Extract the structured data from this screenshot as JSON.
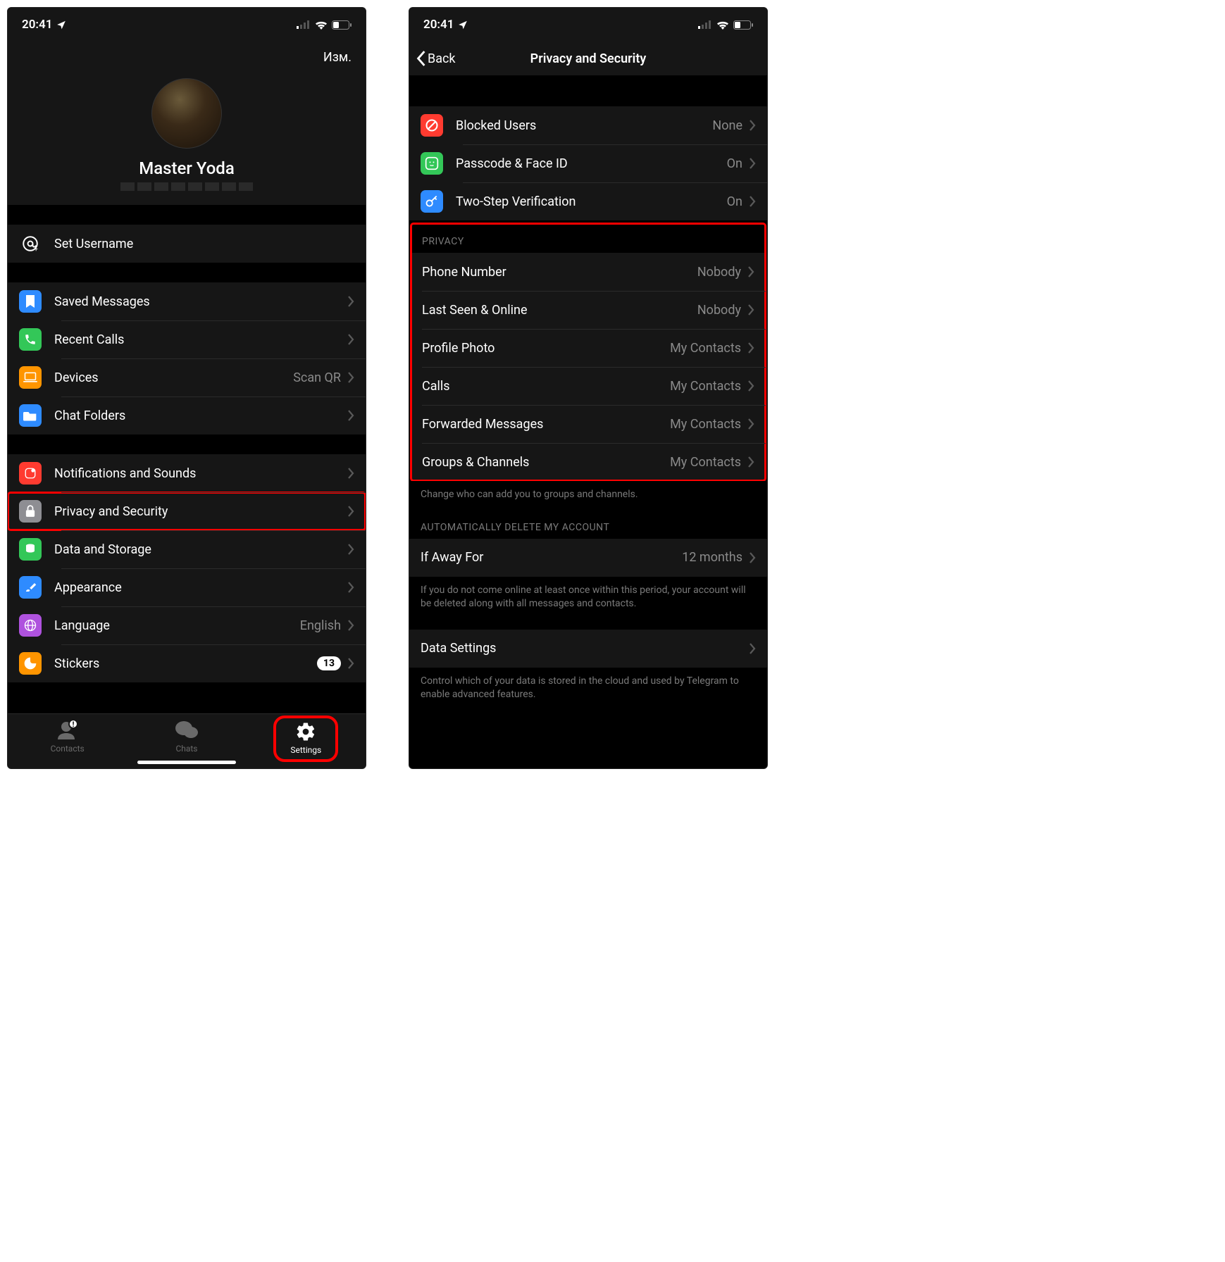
{
  "status": {
    "time": "20:41"
  },
  "left": {
    "edit_label": "Изм.",
    "profile_name": "Master Yoda",
    "rows": {
      "set_username": "Set Username",
      "saved_messages": "Saved Messages",
      "recent_calls": "Recent Calls",
      "devices": "Devices",
      "devices_value": "Scan QR",
      "chat_folders": "Chat Folders",
      "notifications": "Notifications and Sounds",
      "privacy": "Privacy and Security",
      "data_storage": "Data and Storage",
      "appearance": "Appearance",
      "language": "Language",
      "language_value": "English",
      "stickers": "Stickers",
      "stickers_badge": "13"
    },
    "tabs": {
      "contacts": "Contacts",
      "chats": "Chats",
      "settings": "Settings"
    }
  },
  "right": {
    "back_label": "Back",
    "title": "Privacy and Security",
    "security": {
      "blocked": {
        "label": "Blocked Users",
        "value": "None"
      },
      "passcode": {
        "label": "Passcode & Face ID",
        "value": "On"
      },
      "twostep": {
        "label": "Two-Step Verification",
        "value": "On"
      }
    },
    "privacy_header": "PRIVACY",
    "privacy": {
      "phone": {
        "label": "Phone Number",
        "value": "Nobody"
      },
      "lastseen": {
        "label": "Last Seen & Online",
        "value": "Nobody"
      },
      "photo": {
        "label": "Profile Photo",
        "value": "My Contacts"
      },
      "calls": {
        "label": "Calls",
        "value": "My Contacts"
      },
      "forwarded": {
        "label": "Forwarded Messages",
        "value": "My Contacts"
      },
      "groups": {
        "label": "Groups & Channels",
        "value": "My Contacts"
      }
    },
    "privacy_footer": "Change who can add you to groups and channels.",
    "auto_delete_header": "AUTOMATICALLY DELETE MY ACCOUNT",
    "auto_delete": {
      "label": "If Away For",
      "value": "12 months"
    },
    "auto_delete_footer": "If you do not come online at least once within this period, your account will be deleted along with all messages and contacts.",
    "data_settings": {
      "label": "Data Settings"
    },
    "data_settings_footer": "Control which of your data is stored in the cloud and used by Telegram to enable advanced features."
  }
}
